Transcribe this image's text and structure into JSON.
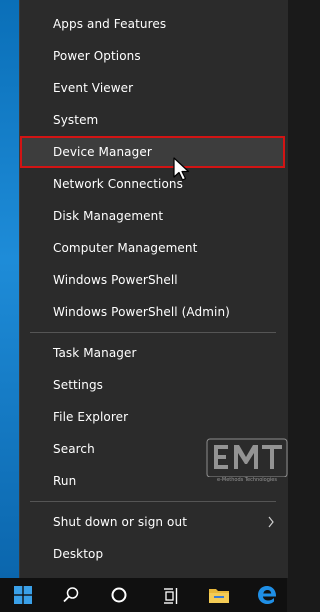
{
  "menu": {
    "items": [
      {
        "label": "Apps and Features"
      },
      {
        "label": "Power Options"
      },
      {
        "label": "Event Viewer"
      },
      {
        "label": "System"
      },
      {
        "label": "Device Manager"
      },
      {
        "label": "Network Connections"
      },
      {
        "label": "Disk Management"
      },
      {
        "label": "Computer Management"
      },
      {
        "label": "Windows PowerShell"
      },
      {
        "label": "Windows PowerShell (Admin)"
      },
      {
        "label": "Task Manager"
      },
      {
        "label": "Settings"
      },
      {
        "label": "File Explorer"
      },
      {
        "label": "Search"
      },
      {
        "label": "Run"
      },
      {
        "label": "Shut down or sign out"
      },
      {
        "label": "Desktop"
      }
    ],
    "highlighted_item": "Device Manager",
    "highlight_color": "#d21414"
  },
  "watermark": {
    "logo_text": "EMT",
    "caption": "e-Methods Technologies"
  },
  "taskbar": {
    "buttons": [
      {
        "icon": "windows-start-icon"
      },
      {
        "icon": "search-icon"
      },
      {
        "icon": "cortana-icon"
      },
      {
        "icon": "task-view-icon"
      },
      {
        "icon": "file-explorer-icon"
      },
      {
        "icon": "edge-icon"
      }
    ]
  },
  "colors": {
    "menu_bg": "#2b2b2b",
    "menu_text": "#ffffff",
    "desktop_blue": "#1e8cd8",
    "taskbar_bg": "#101010"
  }
}
